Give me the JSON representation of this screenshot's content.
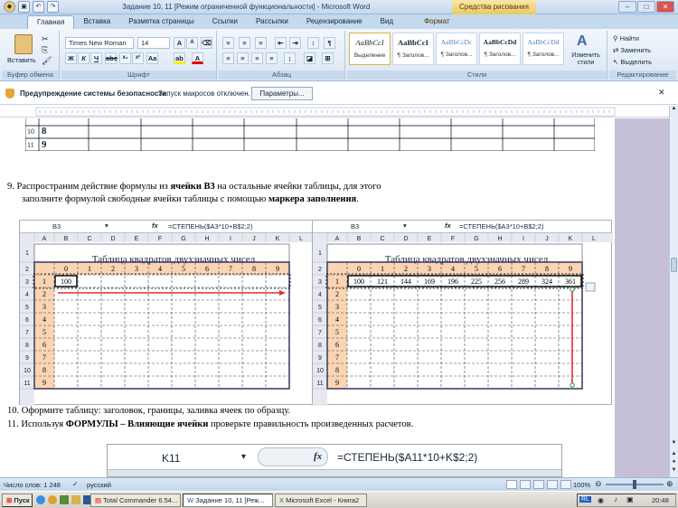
{
  "window": {
    "title": "Задание 10, 11 [Режим ограниченной функциональности] - Microsoft Word",
    "context_tab": "Средства рисования",
    "controls": {
      "minimize": "–",
      "maximize": "□",
      "close": "✕"
    }
  },
  "tabs": [
    "Главная",
    "Вставка",
    "Разметка страницы",
    "Ссылки",
    "Рассылки",
    "Рецензирование",
    "Вид",
    "Формат"
  ],
  "ribbon": {
    "clipboard": {
      "paste": "Вставить",
      "label": "Буфер обмена"
    },
    "font": {
      "name": "Times New Roman",
      "size": "14",
      "label": "Шрифт",
      "bold": "Ж",
      "italic": "К",
      "underline": "Ч"
    },
    "paragraph": {
      "label": "Абзац"
    },
    "styles": {
      "label": "Стили",
      "items": [
        {
          "sample": "AaBbCcI",
          "name": "Выделение"
        },
        {
          "sample": "AaBbCcI",
          "name": "¶ Заголов..."
        },
        {
          "sample": "AaBbCcDc",
          "name": "¶ Заголов..."
        },
        {
          "sample": "AaBbCcDd",
          "name": "¶ Заголов..."
        },
        {
          "sample": "AaBbCcDd",
          "name": "¶ Заголов..."
        }
      ],
      "change": "Изменить стили"
    },
    "editing": {
      "find": "Найти",
      "replace": "Заменить",
      "select": "Выделить",
      "label": "Редактирование"
    }
  },
  "security": {
    "title": "Предупреждение системы безопасности",
    "message": "Запуск макросов отключен.",
    "button": "Параметры..."
  },
  "doc": {
    "top_table_rows": [
      {
        "num": "10",
        "val": "8"
      },
      {
        "num": "11",
        "val": "9"
      }
    ],
    "item9": {
      "num": "9.",
      "part1": "Распространим действие формулы из ",
      "bold1": "ячейки В3",
      "part2": " на остальные ячейки таблицы, для этого",
      "line2": "заполните формулой свободные ячейки таблицы с помощью ",
      "bold2": "маркера заполнения",
      "end": "."
    },
    "excel_left": {
      "cellref": "B3",
      "fx": "fx",
      "formula": "=СТЕПЕНЬ($A3*10+B$2;2)",
      "heading": "Таблица квадратов двухзначных чисел",
      "row3": [
        "100"
      ]
    },
    "excel_right": {
      "cellref": "B3",
      "fx": "fx",
      "formula": "=СТЕПЕНЬ($A3*10+B$2;2)",
      "heading": "Таблица квадратов двухзначных чисел",
      "row3": [
        "100",
        "121",
        "144",
        "169",
        "196",
        "225",
        "256",
        "289",
        "324",
        "361"
      ]
    },
    "col_letters": [
      "A",
      "B",
      "C",
      "D",
      "E",
      "F",
      "G",
      "H",
      "I",
      "J",
      "K",
      "L"
    ],
    "row_numbers": [
      "1",
      "2",
      "3",
      "4",
      "5",
      "6",
      "7",
      "8",
      "9",
      "10",
      "11"
    ],
    "header_digits": [
      "0",
      "1",
      "2",
      "3",
      "4",
      "5",
      "6",
      "7",
      "8",
      "9"
    ],
    "col_a_values": [
      "1",
      "2",
      "3",
      "4",
      "5",
      "6",
      "7",
      "8",
      "9"
    ],
    "item10": "10. Оформите таблицу: заголовок, границы, заливка ячеек по образцу.",
    "item11": {
      "part1": "11. Используя ",
      "bold": "ФОРМУЛЫ – Влияющие ячейки",
      "part2": "  проверьте правильность произведенных расчетов."
    },
    "excel_bottom": {
      "cellref": "K11",
      "fx": "fx",
      "formula": "=СТЕПЕНЬ($A11*10+K$2;2)"
    }
  },
  "statusbar": {
    "words": "Число слов: 1 248",
    "lang": "русский",
    "zoom": "100%"
  },
  "taskbar": {
    "start": "Пуск",
    "items": [
      {
        "label": "Total Commander 6.54...",
        "active": false
      },
      {
        "label": "Задание 10, 11 [Реж...",
        "active": true
      },
      {
        "label": "Microsoft Excel - Книга2",
        "active": false
      }
    ],
    "lang": "RL",
    "clock": "20:48"
  },
  "colors": {
    "accent": "#2b579a",
    "header_fill": "#fbd4b4",
    "arrow": "#e03030"
  }
}
